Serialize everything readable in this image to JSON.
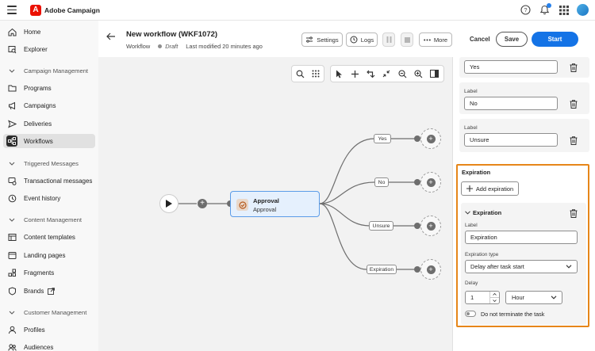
{
  "app": {
    "name": "Adobe Campaign"
  },
  "sidebar": {
    "items": [
      {
        "label": "Home",
        "icon": "home-icon"
      },
      {
        "label": "Explorer",
        "icon": "explorer-icon"
      }
    ],
    "sections": [
      {
        "label": "Campaign Management",
        "items": [
          {
            "label": "Programs",
            "icon": "folder-icon"
          },
          {
            "label": "Campaigns",
            "icon": "megaphone-icon"
          },
          {
            "label": "Deliveries",
            "icon": "send-icon"
          },
          {
            "label": "Workflows",
            "icon": "workflow-icon",
            "active": true
          }
        ]
      },
      {
        "label": "Triggered Messages",
        "items": [
          {
            "label": "Transactional messages",
            "icon": "transactional-icon"
          },
          {
            "label": "Event history",
            "icon": "history-icon"
          }
        ]
      },
      {
        "label": "Content Management",
        "items": [
          {
            "label": "Content templates",
            "icon": "template-icon"
          },
          {
            "label": "Landing pages",
            "icon": "landing-page-icon"
          },
          {
            "label": "Fragments",
            "icon": "fragments-icon"
          },
          {
            "label": "Brands",
            "icon": "brands-icon"
          }
        ]
      },
      {
        "label": "Customer Management",
        "items": [
          {
            "label": "Profiles",
            "icon": "profile-icon"
          },
          {
            "label": "Audiences",
            "icon": "audiences-icon"
          }
        ]
      }
    ]
  },
  "header": {
    "title": "New workflow (WKF1072)",
    "type": "Workflow",
    "status": "Draft",
    "modified": "Last modified 20 minutes ago",
    "settings_label": "Settings",
    "logs_label": "Logs",
    "more_label": "More",
    "cancel_label": "Cancel",
    "save_label": "Save",
    "start_label": "Start"
  },
  "canvas": {
    "node": {
      "title": "Approval",
      "subtitle": "Approval"
    },
    "outputs": [
      "Yes",
      "No",
      "Unsure",
      "Expiration"
    ]
  },
  "panel": {
    "options": [
      {
        "label": "",
        "value": "Yes"
      },
      {
        "label": "Label",
        "value": "No"
      },
      {
        "label": "Label",
        "value": "Unsure"
      }
    ],
    "expiration": {
      "title": "Expiration",
      "add_label": "Add expiration",
      "card_title": "Expiration",
      "label_label": "Label",
      "label_value": "Expiration",
      "type_label": "Expiration type",
      "type_value": "Delay after task start",
      "delay_label": "Delay",
      "delay_value": "1",
      "unit_value": "Hour",
      "toggle_label": "Do not terminate the task"
    }
  },
  "colors": {
    "accent": "#1473e6",
    "highlight": "#e68619",
    "logo": "#eb1000"
  }
}
